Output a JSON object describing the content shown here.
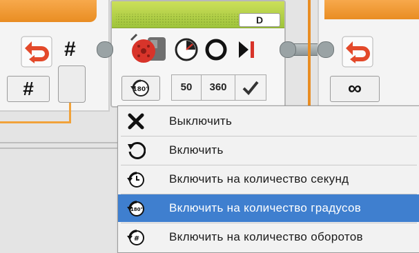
{
  "left_block": {
    "hash_symbol": "#",
    "number_button_label": "#"
  },
  "motor_block": {
    "port": "D",
    "params": [
      "50",
      "360"
    ],
    "mode_icon": "rotate-degrees-icon",
    "colors": {
      "header": "#9ec43b",
      "selected": "#3f7fcf"
    }
  },
  "right_block": {
    "loop_mode_label": "∞"
  },
  "menu": {
    "items": [
      {
        "icon": "stop-x-icon",
        "label": "Выключить"
      },
      {
        "icon": "rotate-on-icon",
        "label": "Включить"
      },
      {
        "icon": "rotate-seconds-icon",
        "label": "Включить на количество секунд"
      },
      {
        "icon": "rotate-degrees-icon",
        "label": "Включить на количество градусов",
        "selected": true
      },
      {
        "icon": "rotate-rotations-icon",
        "label": "Включить на количество оборотов"
      }
    ]
  }
}
